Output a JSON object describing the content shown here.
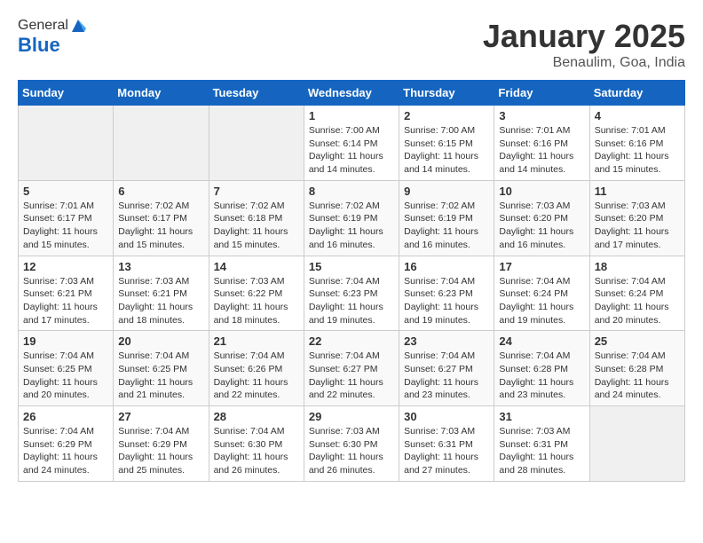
{
  "logo": {
    "general": "General",
    "blue": "Blue"
  },
  "header": {
    "month": "January 2025",
    "location": "Benaulim, Goa, India"
  },
  "days_of_week": [
    "Sunday",
    "Monday",
    "Tuesday",
    "Wednesday",
    "Thursday",
    "Friday",
    "Saturday"
  ],
  "weeks": [
    [
      {
        "day": "",
        "info": ""
      },
      {
        "day": "",
        "info": ""
      },
      {
        "day": "",
        "info": ""
      },
      {
        "day": "1",
        "info": "Sunrise: 7:00 AM\nSunset: 6:14 PM\nDaylight: 11 hours\nand 14 minutes."
      },
      {
        "day": "2",
        "info": "Sunrise: 7:00 AM\nSunset: 6:15 PM\nDaylight: 11 hours\nand 14 minutes."
      },
      {
        "day": "3",
        "info": "Sunrise: 7:01 AM\nSunset: 6:16 PM\nDaylight: 11 hours\nand 14 minutes."
      },
      {
        "day": "4",
        "info": "Sunrise: 7:01 AM\nSunset: 6:16 PM\nDaylight: 11 hours\nand 15 minutes."
      }
    ],
    [
      {
        "day": "5",
        "info": "Sunrise: 7:01 AM\nSunset: 6:17 PM\nDaylight: 11 hours\nand 15 minutes."
      },
      {
        "day": "6",
        "info": "Sunrise: 7:02 AM\nSunset: 6:17 PM\nDaylight: 11 hours\nand 15 minutes."
      },
      {
        "day": "7",
        "info": "Sunrise: 7:02 AM\nSunset: 6:18 PM\nDaylight: 11 hours\nand 15 minutes."
      },
      {
        "day": "8",
        "info": "Sunrise: 7:02 AM\nSunset: 6:19 PM\nDaylight: 11 hours\nand 16 minutes."
      },
      {
        "day": "9",
        "info": "Sunrise: 7:02 AM\nSunset: 6:19 PM\nDaylight: 11 hours\nand 16 minutes."
      },
      {
        "day": "10",
        "info": "Sunrise: 7:03 AM\nSunset: 6:20 PM\nDaylight: 11 hours\nand 16 minutes."
      },
      {
        "day": "11",
        "info": "Sunrise: 7:03 AM\nSunset: 6:20 PM\nDaylight: 11 hours\nand 17 minutes."
      }
    ],
    [
      {
        "day": "12",
        "info": "Sunrise: 7:03 AM\nSunset: 6:21 PM\nDaylight: 11 hours\nand 17 minutes."
      },
      {
        "day": "13",
        "info": "Sunrise: 7:03 AM\nSunset: 6:21 PM\nDaylight: 11 hours\nand 18 minutes."
      },
      {
        "day": "14",
        "info": "Sunrise: 7:03 AM\nSunset: 6:22 PM\nDaylight: 11 hours\nand 18 minutes."
      },
      {
        "day": "15",
        "info": "Sunrise: 7:04 AM\nSunset: 6:23 PM\nDaylight: 11 hours\nand 19 minutes."
      },
      {
        "day": "16",
        "info": "Sunrise: 7:04 AM\nSunset: 6:23 PM\nDaylight: 11 hours\nand 19 minutes."
      },
      {
        "day": "17",
        "info": "Sunrise: 7:04 AM\nSunset: 6:24 PM\nDaylight: 11 hours\nand 19 minutes."
      },
      {
        "day": "18",
        "info": "Sunrise: 7:04 AM\nSunset: 6:24 PM\nDaylight: 11 hours\nand 20 minutes."
      }
    ],
    [
      {
        "day": "19",
        "info": "Sunrise: 7:04 AM\nSunset: 6:25 PM\nDaylight: 11 hours\nand 20 minutes."
      },
      {
        "day": "20",
        "info": "Sunrise: 7:04 AM\nSunset: 6:25 PM\nDaylight: 11 hours\nand 21 minutes."
      },
      {
        "day": "21",
        "info": "Sunrise: 7:04 AM\nSunset: 6:26 PM\nDaylight: 11 hours\nand 22 minutes."
      },
      {
        "day": "22",
        "info": "Sunrise: 7:04 AM\nSunset: 6:27 PM\nDaylight: 11 hours\nand 22 minutes."
      },
      {
        "day": "23",
        "info": "Sunrise: 7:04 AM\nSunset: 6:27 PM\nDaylight: 11 hours\nand 23 minutes."
      },
      {
        "day": "24",
        "info": "Sunrise: 7:04 AM\nSunset: 6:28 PM\nDaylight: 11 hours\nand 23 minutes."
      },
      {
        "day": "25",
        "info": "Sunrise: 7:04 AM\nSunset: 6:28 PM\nDaylight: 11 hours\nand 24 minutes."
      }
    ],
    [
      {
        "day": "26",
        "info": "Sunrise: 7:04 AM\nSunset: 6:29 PM\nDaylight: 11 hours\nand 24 minutes."
      },
      {
        "day": "27",
        "info": "Sunrise: 7:04 AM\nSunset: 6:29 PM\nDaylight: 11 hours\nand 25 minutes."
      },
      {
        "day": "28",
        "info": "Sunrise: 7:04 AM\nSunset: 6:30 PM\nDaylight: 11 hours\nand 26 minutes."
      },
      {
        "day": "29",
        "info": "Sunrise: 7:03 AM\nSunset: 6:30 PM\nDaylight: 11 hours\nand 26 minutes."
      },
      {
        "day": "30",
        "info": "Sunrise: 7:03 AM\nSunset: 6:31 PM\nDaylight: 11 hours\nand 27 minutes."
      },
      {
        "day": "31",
        "info": "Sunrise: 7:03 AM\nSunset: 6:31 PM\nDaylight: 11 hours\nand 28 minutes."
      },
      {
        "day": "",
        "info": ""
      }
    ]
  ]
}
